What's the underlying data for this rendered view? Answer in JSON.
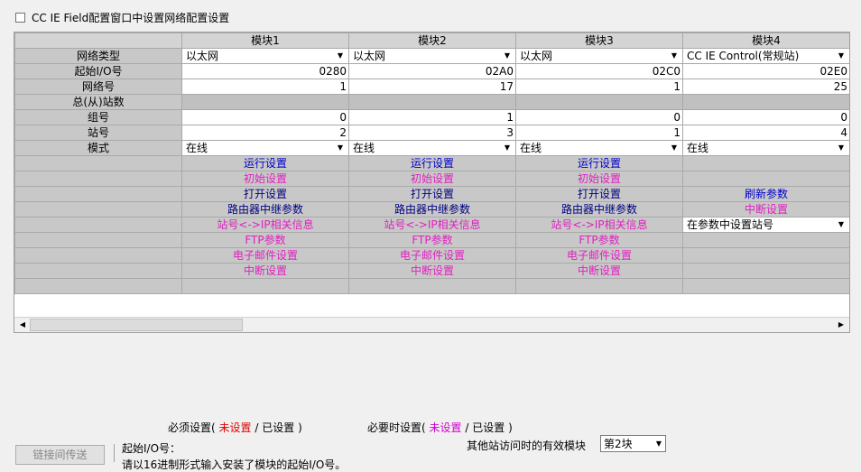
{
  "top_checkbox": {
    "label": "CC IE Field配置窗口中设置网络配置设置",
    "checked": false
  },
  "columns": [
    "模块1",
    "模块2",
    "模块3",
    "模块4"
  ],
  "rows": {
    "network_type": {
      "label": "网络类型",
      "values": [
        "以太网",
        "以太网",
        "以太网",
        "CC IE Control(常规站)"
      ]
    },
    "start_io": {
      "label": "起始I/O号",
      "values": [
        "0280",
        "02A0",
        "02C0",
        "02E0"
      ]
    },
    "network_no": {
      "label": "网络号",
      "values": [
        "1",
        "17",
        "1",
        "25"
      ]
    },
    "total_stations": {
      "label": "总(从)站数",
      "values": [
        "",
        "",
        "",
        ""
      ]
    },
    "group_no": {
      "label": "组号",
      "values": [
        "0",
        "1",
        "0",
        "0"
      ]
    },
    "station_no": {
      "label": "站号",
      "values": [
        "2",
        "3",
        "1",
        "4"
      ]
    },
    "mode": {
      "label": "模式",
      "values": [
        "在线",
        "在线",
        "在线",
        "在线"
      ]
    }
  },
  "buttons": {
    "m1": [
      "运行设置",
      "初始设置",
      "打开设置",
      "路由器中继参数",
      "站号<->IP相关信息",
      "FTP参数",
      "电子邮件设置",
      "中断设置"
    ],
    "m2": [
      "运行设置",
      "初始设置",
      "打开设置",
      "路由器中继参数",
      "站号<->IP相关信息",
      "FTP参数",
      "电子邮件设置",
      "中断设置"
    ],
    "m3": [
      "运行设置",
      "初始设置",
      "打开设置",
      "路由器中继参数",
      "站号<->IP相关信息",
      "FTP参数",
      "电子邮件设置",
      "中断设置"
    ],
    "m4": [
      "刷新参数",
      "中断设置",
      "在参数中设置站号"
    ]
  },
  "legend": {
    "required_prefix": "必须设置(",
    "required_unset": "未设置",
    "slash": "/",
    "required_set": "已设置",
    "required_suffix": ")",
    "optional_prefix": "必要时设置(",
    "optional_unset": "未设置",
    "optional_set": "已设置",
    "optional_suffix": ")"
  },
  "link_button": "链接间传送",
  "start_io_label": "起始I/O号：",
  "cut_text": "请以16进制形式输入安装了模块的起始I/O号。",
  "other_station_label": "其他站访问时的有效模块",
  "other_station_value": "第2块",
  "colors": {
    "blue_link": "#0000cc",
    "magenta_link": "#e020c0",
    "red": "#e00000"
  }
}
